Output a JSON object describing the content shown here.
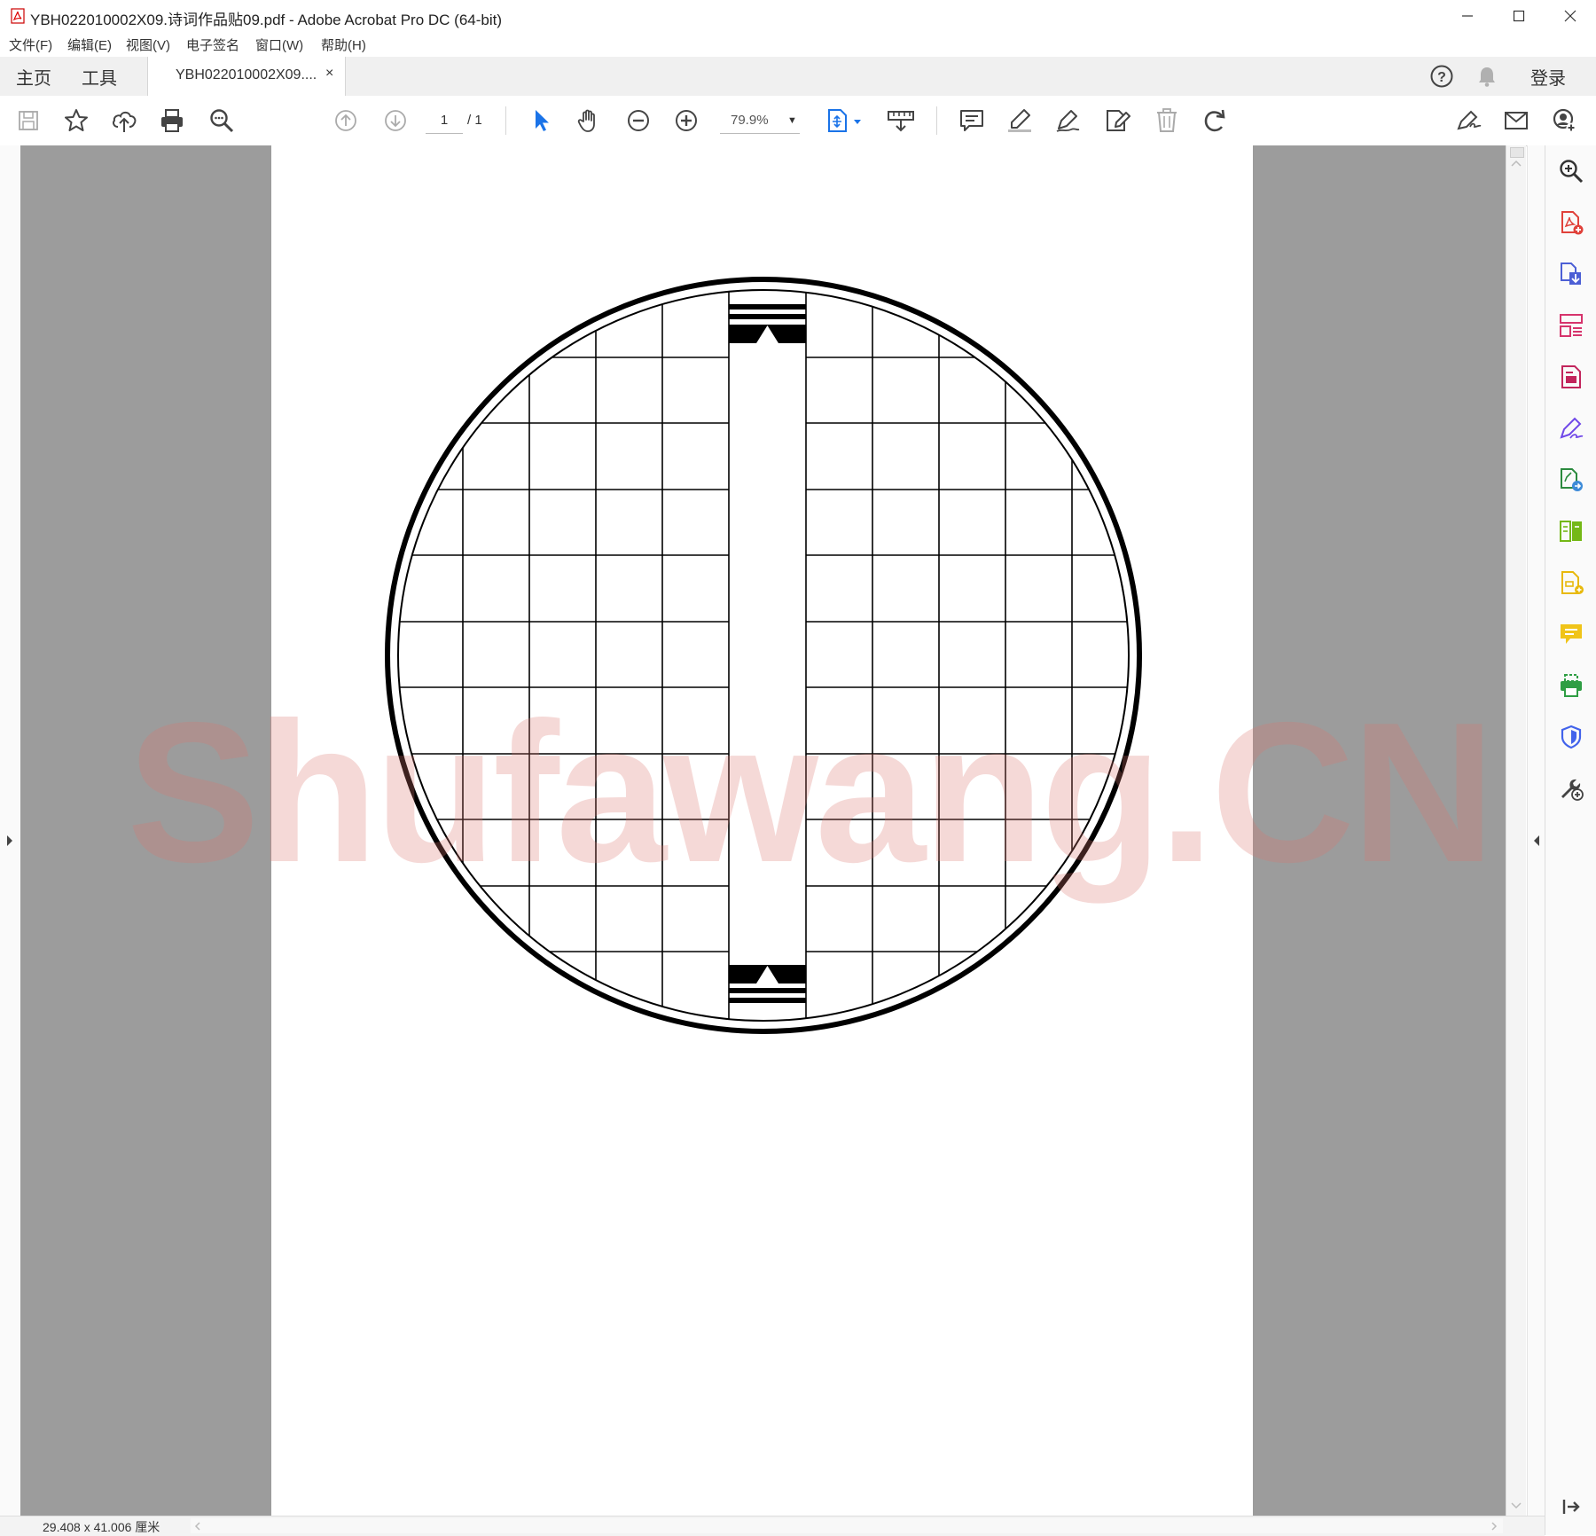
{
  "window": {
    "title": "YBH022010002X09.诗词作品贴09.pdf - Adobe Acrobat Pro DC (64-bit)",
    "minimize": "─",
    "maximize": "☐",
    "close": "✕"
  },
  "menu": {
    "items": [
      "文件(F)",
      "编辑(E)",
      "视图(V)",
      "电子签名",
      "窗口(W)",
      "帮助(H)"
    ]
  },
  "tabs": {
    "home": "主页",
    "tools": "工具",
    "document": "YBH022010002X09....",
    "document_close": "×",
    "help": "?",
    "login": "登录"
  },
  "toolbar": {
    "page_current": "1",
    "page_total": "/ 1",
    "zoom": "79.9%"
  },
  "status": {
    "page_size": "29.408 x 41.006 厘米"
  },
  "watermark": "Shufawang.CN",
  "colors": {
    "viewer_bg": "#9c9c9c",
    "accent_blue": "#1a73e8",
    "watermark": "rgba(220,120,110,0.28)"
  },
  "right_panel_icons": [
    "search-zoom-icon",
    "create-pdf-icon",
    "export-pdf-icon",
    "organize-pages-icon",
    "edit-pdf-icon",
    "fill-sign-icon",
    "send-for-signature-icon",
    "compare-files-icon",
    "create-form-icon",
    "comment-icon",
    "print-production-icon",
    "protect-icon",
    "more-tools-icon"
  ]
}
